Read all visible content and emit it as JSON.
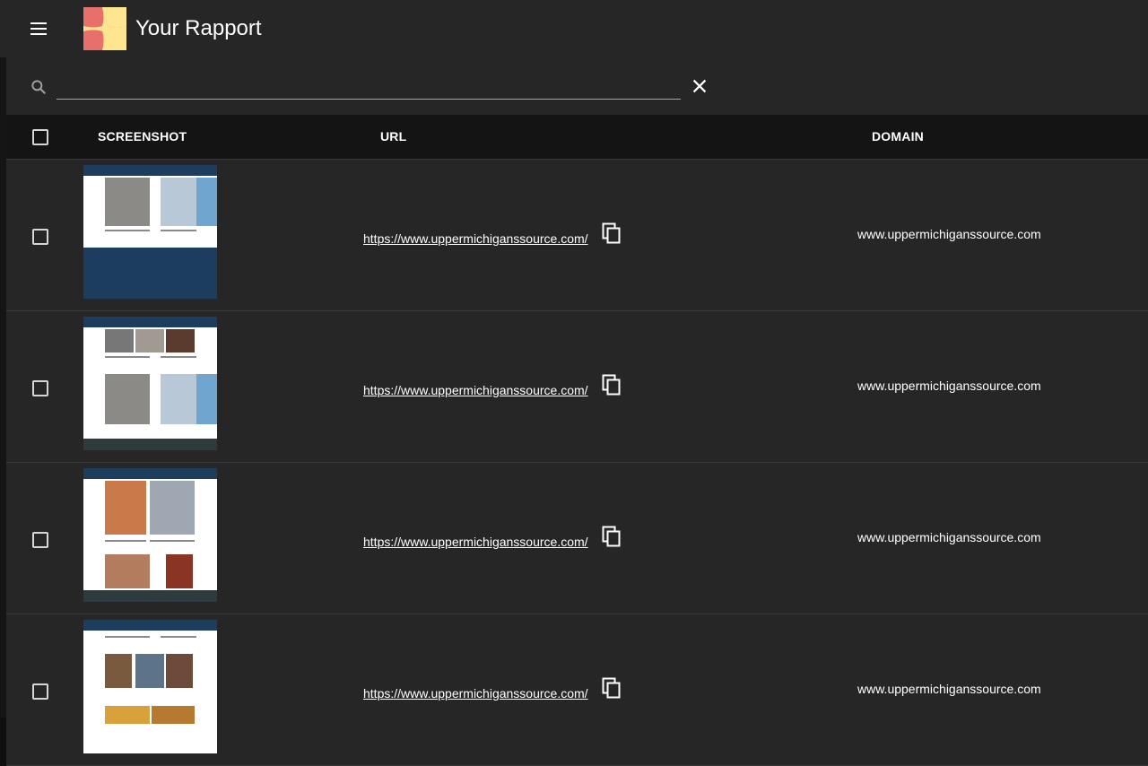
{
  "app": {
    "title": "Your Rapport",
    "logo_colors": [
      "#e8706b",
      "#fde68f"
    ],
    "menu_icon": "hamburger-menu-icon"
  },
  "search": {
    "value": "",
    "placeholder": "",
    "icon": "search-icon",
    "clear_icon": "close-icon"
  },
  "table": {
    "columns": [
      "SCREENSHOT",
      "URL",
      "DOMAIN"
    ],
    "rows": [
      {
        "url": "https://www.uppermichiganssource.com/",
        "domain": "www.uppermichiganssource.com",
        "checked": false
      },
      {
        "url": "https://www.uppermichiganssource.com/",
        "domain": "www.uppermichiganssource.com",
        "checked": false
      },
      {
        "url": "https://www.uppermichiganssource.com/",
        "domain": "www.uppermichiganssource.com",
        "checked": false
      },
      {
        "url": "https://www.uppermichiganssource.com/",
        "domain": "www.uppermichiganssource.com",
        "checked": false
      }
    ]
  },
  "colors": {
    "appbar": "#262626",
    "row_bg": "#262626",
    "header_bg": "#141414",
    "site_header": "#1d3d5e"
  }
}
